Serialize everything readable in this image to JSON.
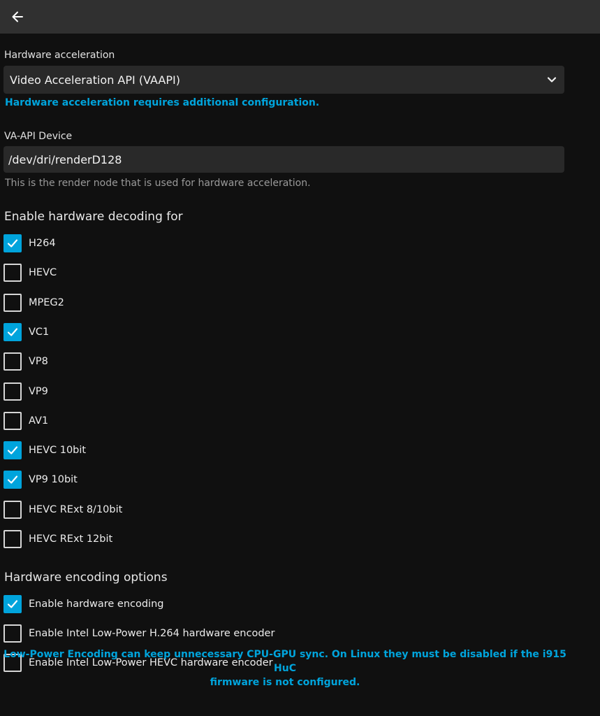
{
  "hw_accel": {
    "label": "Hardware acceleration",
    "selected": "Video Acceleration API (VAAPI)",
    "config_link": "Hardware acceleration requires additional configuration."
  },
  "vaapi": {
    "label": "VA-API Device",
    "value": "/dev/dri/renderD128",
    "help": "This is the render node that is used for hardware acceleration."
  },
  "decoding": {
    "title": "Enable hardware decoding for",
    "items": [
      {
        "label": "H264",
        "checked": true
      },
      {
        "label": "HEVC",
        "checked": false
      },
      {
        "label": "MPEG2",
        "checked": false
      },
      {
        "label": "VC1",
        "checked": true
      },
      {
        "label": "VP8",
        "checked": false
      },
      {
        "label": "VP9",
        "checked": false
      },
      {
        "label": "AV1",
        "checked": false
      },
      {
        "label": "HEVC 10bit",
        "checked": true
      },
      {
        "label": "VP9 10bit",
        "checked": true
      },
      {
        "label": "HEVC RExt 8/10bit",
        "checked": false
      },
      {
        "label": "HEVC RExt 12bit",
        "checked": false
      }
    ]
  },
  "encoding": {
    "title": "Hardware encoding options",
    "items": [
      {
        "label": "Enable hardware encoding",
        "checked": true
      },
      {
        "label": "Enable Intel Low-Power H.264 hardware encoder",
        "checked": false
      },
      {
        "label": "Enable Intel Low-Power HEVC hardware encoder",
        "checked": false
      }
    ],
    "note_line1": "Low-Power Encoding can keep unnecessary CPU-GPU sync. On Linux they must be disabled if the i915 HuC",
    "note_line2": "firmware is not configured."
  },
  "colors": {
    "accent": "#00a4dc",
    "header_bg": "#303030",
    "page_bg": "#101010",
    "input_bg": "#292929"
  },
  "icons": {
    "back": "back-arrow-icon",
    "dropdown": "chevron-down-icon",
    "check": "checkmark-icon"
  }
}
